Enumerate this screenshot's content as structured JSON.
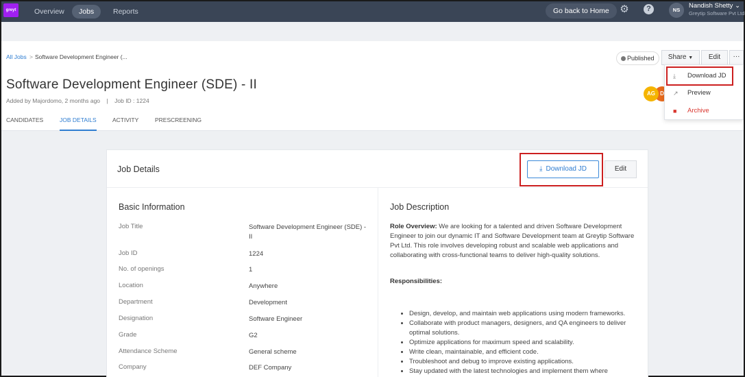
{
  "nav": {
    "logo_text": "greyt",
    "items": [
      "Overview",
      "Jobs",
      "Reports"
    ],
    "home_button": "Go back to Home",
    "user_initials": "NS",
    "user_name": "Nandish Shetty",
    "company": "Greytip Software Pvt Ltd"
  },
  "breadcrumb": {
    "root": "All Jobs",
    "separator": ">",
    "current": "Software Development Engineer (..."
  },
  "job": {
    "title": "Software Development Engineer (SDE) - II",
    "meta": "Added by Majordomo, 2 months ago    |    Job ID : 1224"
  },
  "tabs": [
    "CANDIDATES",
    "JOB DETAILS",
    "ACTIVITY",
    "PRESCREENING"
  ],
  "header_actions": {
    "published": "Published",
    "share": "Share",
    "edit": "Edit",
    "more": "···"
  },
  "avatars": [
    "AG",
    "D"
  ],
  "dropdown": {
    "items": [
      {
        "label": "Download JD",
        "icon": "download-icon"
      },
      {
        "label": "Preview",
        "icon": "external-link-icon"
      },
      {
        "label": "Archive",
        "icon": "archive-icon"
      }
    ]
  },
  "card": {
    "title": "Job Details",
    "download_button": "Download JD",
    "edit_button": "Edit"
  },
  "basic_info": {
    "title": "Basic Information",
    "rows": [
      {
        "label": "Job Title",
        "value": "Software Development Engineer (SDE) - II"
      },
      {
        "label": "Job ID",
        "value": "1224"
      },
      {
        "label": "No. of openings",
        "value": "1"
      },
      {
        "label": "Location",
        "value": "Anywhere"
      },
      {
        "label": "Department",
        "value": "Development"
      },
      {
        "label": "Designation",
        "value": "Software Engineer"
      },
      {
        "label": "Grade",
        "value": "G2"
      },
      {
        "label": "Attendance Scheme",
        "value": "General scheme"
      },
      {
        "label": "Company",
        "value": "DEF Company"
      }
    ]
  },
  "job_description": {
    "title": "Job Description",
    "overview_label": "Role Overview:",
    "overview_text": " We are looking for a talented and driven Software Development Engineer to join our dynamic IT and Software Development team at Greytip Software Pvt Ltd. This role involves developing robust and scalable web applications and collaborating with cross-functional teams to deliver high-quality solutions.",
    "responsibilities_label": "Responsibilities:",
    "responsibilities": [
      "Design, develop, and maintain web applications using modern frameworks.",
      "Collaborate with product managers, designers, and QA engineers to deliver optimal solutions.",
      "Optimize applications for maximum speed and scalability.",
      "Write clean, maintainable, and efficient code.",
      "Troubleshoot and debug to improve existing applications.",
      "Stay updated with the latest technologies and implement them where"
    ]
  }
}
